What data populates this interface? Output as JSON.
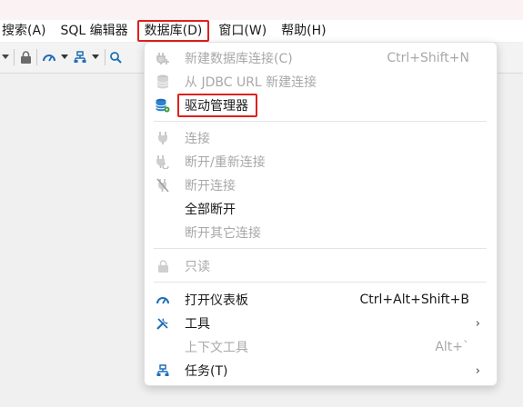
{
  "menubar": {
    "items": [
      {
        "label": "搜索(A)"
      },
      {
        "label": "SQL 编辑器"
      },
      {
        "label": "数据库(D)"
      },
      {
        "label": "窗口(W)"
      },
      {
        "label": "帮助(H)"
      }
    ],
    "active_index": 2
  },
  "toolbar": {
    "icons": [
      "chevron-down-icon",
      "lock-icon",
      "dashboard-icon",
      "chevron-down-icon",
      "network-icon",
      "chevron-down-icon",
      "search-icon"
    ]
  },
  "dropdown": {
    "items": [
      {
        "label": "新建数据库连接(C)",
        "shortcut": "Ctrl+Shift+N",
        "icon": "plug-add-icon",
        "disabled": true
      },
      {
        "label": "从 JDBC URL 新建连接",
        "shortcut": "",
        "icon": "database-icon",
        "disabled": true
      },
      {
        "label": "驱动管理器",
        "shortcut": "",
        "icon": "database-gear-icon",
        "disabled": false,
        "highlighted": true
      },
      {
        "label": "连接",
        "shortcut": "",
        "icon": "plug-icon",
        "disabled": true
      },
      {
        "label": "断开/重新连接",
        "shortcut": "",
        "icon": "plug-refresh-icon",
        "disabled": true
      },
      {
        "label": "断开连接",
        "shortcut": "",
        "icon": "plug-disconnect-icon",
        "disabled": true
      },
      {
        "label": "全部断开",
        "shortcut": "",
        "icon": "",
        "disabled": false
      },
      {
        "label": "断开其它连接",
        "shortcut": "",
        "icon": "",
        "disabled": true
      },
      {
        "label": "只读",
        "shortcut": "",
        "icon": "lock-icon",
        "disabled": true
      },
      {
        "label": "打开仪表板",
        "shortcut": "Ctrl+Alt+Shift+B",
        "icon": "dashboard-icon",
        "disabled": false
      },
      {
        "label": "工具",
        "shortcut": "",
        "icon": "tools-icon",
        "disabled": false,
        "submenu": true
      },
      {
        "label": "上下文工具",
        "shortcut": "Alt+`",
        "icon": "",
        "disabled": true
      },
      {
        "label": "任务(T)",
        "shortcut": "",
        "icon": "tasks-icon",
        "disabled": false,
        "submenu": true
      }
    ],
    "submenu_arrow": "›"
  },
  "colors": {
    "highlight_border": "#e0201c",
    "disabled_text": "#a8a8a8",
    "icon_blue": "#1f6fb8"
  }
}
